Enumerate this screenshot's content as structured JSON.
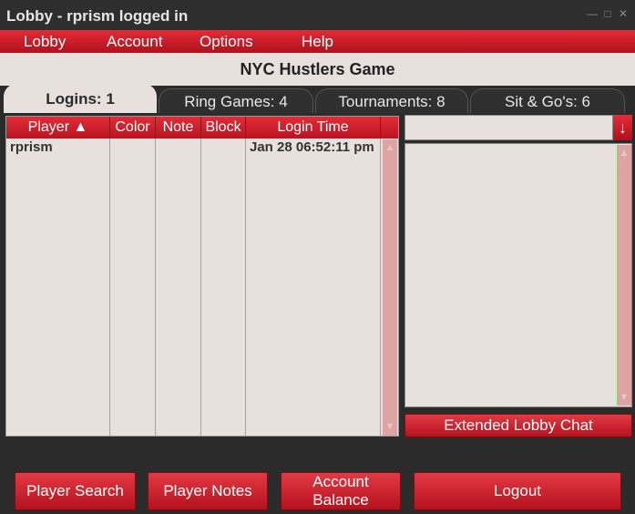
{
  "window": {
    "title": "Lobby - rprism logged in"
  },
  "menu": {
    "items": [
      "Lobby",
      "Account",
      "Options",
      "Help"
    ]
  },
  "header": {
    "title": "NYC Hustlers Game"
  },
  "tabs": [
    {
      "label": "Logins: 1",
      "active": true
    },
    {
      "label": "Ring Games: 4",
      "active": false
    },
    {
      "label": "Tournaments: 8",
      "active": false
    },
    {
      "label": "Sit & Go's: 6",
      "active": false
    }
  ],
  "table": {
    "columns": [
      "Player ▲",
      "Color",
      "Note",
      "Block",
      "Login Time"
    ],
    "rows": [
      {
        "player": "rprism",
        "color": "",
        "note": "",
        "block": "",
        "login_time": "Jan 28 06:52:11 pm"
      }
    ]
  },
  "chat": {
    "input_value": "",
    "send_icon": "arrow-down-icon",
    "extended_button": "Extended Lobby Chat"
  },
  "buttons": {
    "player_search": "Player Search",
    "player_notes": "Player Notes",
    "account_balance": "Account Balance",
    "logout": "Logout"
  },
  "colors": {
    "accent_red": "#d71f2b",
    "panel_bg": "#e7e0dc",
    "chrome_dark": "#2b2b2b"
  }
}
